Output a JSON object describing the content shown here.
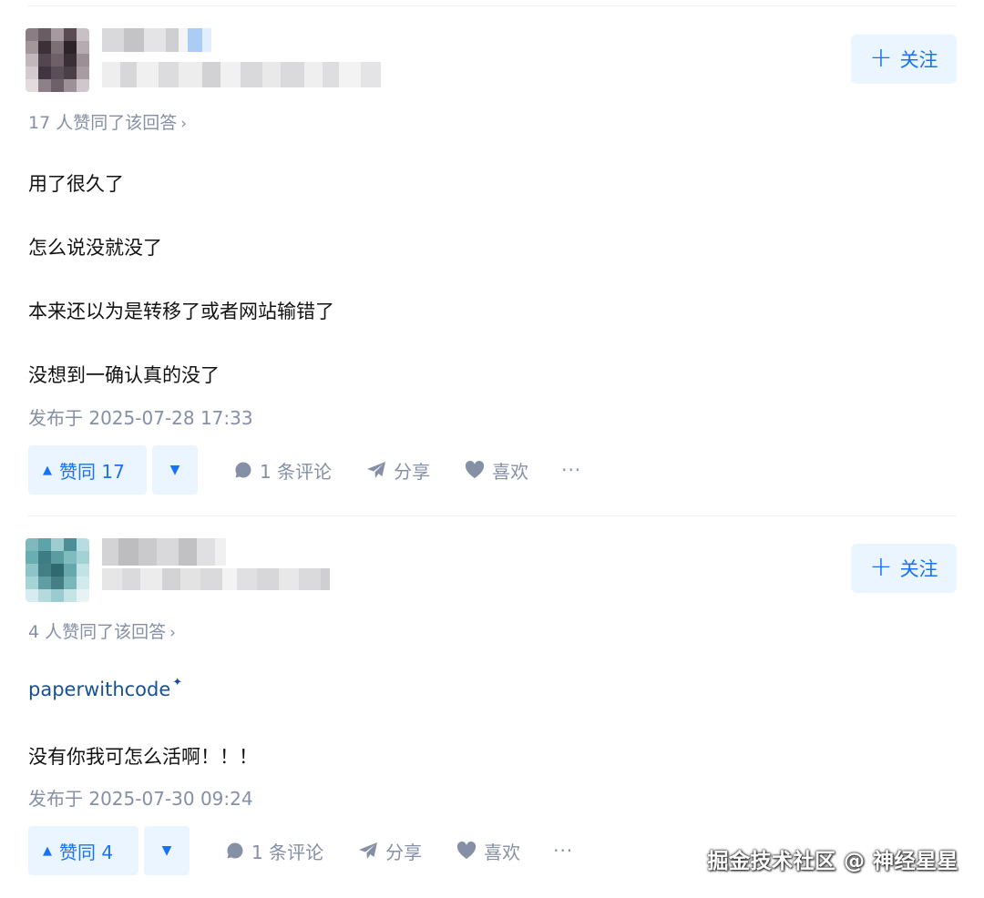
{
  "answers": [
    {
      "follow_label": "关注",
      "voters_text": "17 人赞同了该回答",
      "paragraphs": [
        "用了很久了",
        "怎么说没就没了",
        "本来还以为是转移了或者网站输错了",
        "没想到一确认真的没了"
      ],
      "published": "发布于 2025-07-28 17:33",
      "vote_up_label": "赞同 17",
      "comment_label": "1 条评论",
      "share_label": "分享",
      "like_label": "喜欢",
      "more_label": "···"
    },
    {
      "follow_label": "关注",
      "voters_text": "4 人赞同了该回答",
      "link_text": "paperwithcode",
      "link_mark": "✦",
      "paragraphs": [
        "没有你我可怎么活啊！！！"
      ],
      "published": "发布于 2025-07-30 09:24",
      "vote_up_label": "赞同 4",
      "comment_label": "1 条评论",
      "share_label": "分享",
      "like_label": "喜欢",
      "more_label": "···"
    }
  ],
  "voters_chevron": "›",
  "vote_up_icon": "▲",
  "vote_down_icon": "▼",
  "watermark": "掘金技术社区 @ 神经星星",
  "colors": {
    "accent": "#1772f6",
    "accent_bg": "#ebf5ff",
    "meta_text": "#8590a6",
    "link": "#175199"
  },
  "icons": [
    "plus-icon",
    "comment-icon",
    "share-icon",
    "heart-icon",
    "more-icon"
  ]
}
